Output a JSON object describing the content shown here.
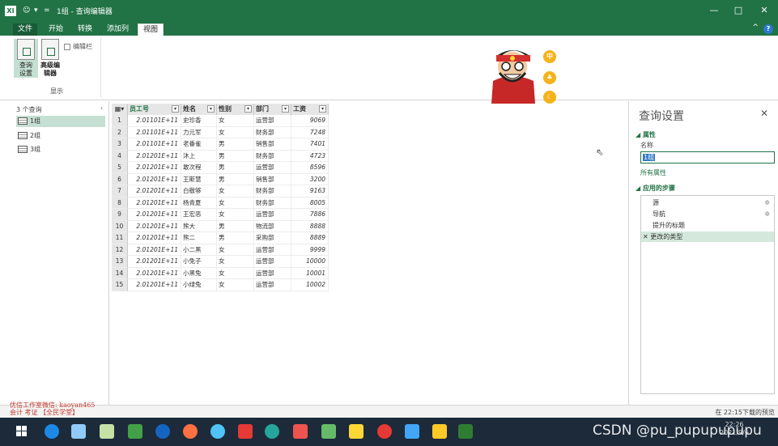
{
  "window": {
    "app_badge": "XΙ",
    "title": "1组 - 查询编辑器",
    "controls": [
      "—",
      "□",
      "✕"
    ]
  },
  "ribbon": {
    "tabs": [
      {
        "label": "文件"
      },
      {
        "label": "开始"
      },
      {
        "label": "转换"
      },
      {
        "label": "添加列"
      },
      {
        "label": "视图"
      }
    ],
    "buttons": {
      "query_settings": "查询\n设置",
      "advanced_editor": "高级编\n辑器",
      "formula_bar": "编辑栏"
    },
    "group_label": "显示"
  },
  "mascot_badges": [
    "中",
    "",
    ""
  ],
  "queries_pane": {
    "header": "3 个查询",
    "items": [
      {
        "label": "1组",
        "selected": true
      },
      {
        "label": "2组",
        "selected": false
      },
      {
        "label": "3组",
        "selected": false
      }
    ]
  },
  "grid": {
    "columns": [
      "员工号",
      "姓名",
      "性别",
      "部门",
      "工资"
    ],
    "rows": [
      {
        "n": "1",
        "id": "2.01101E+11",
        "name": "史珍香",
        "sex": "女",
        "dept": "运营部",
        "salary": "9069"
      },
      {
        "n": "2",
        "id": "2.01101E+11",
        "name": "力元军",
        "sex": "女",
        "dept": "财务部",
        "salary": "7248"
      },
      {
        "n": "3",
        "id": "2.01101E+11",
        "name": "老番雀",
        "sex": "男",
        "dept": "销售部",
        "salary": "7401"
      },
      {
        "n": "4",
        "id": "2.01201E+11",
        "name": "沐上",
        "sex": "男",
        "dept": "财务部",
        "salary": "4723"
      },
      {
        "n": "5",
        "id": "2.01201E+11",
        "name": "敢次程",
        "sex": "男",
        "dept": "运营部",
        "salary": "8596"
      },
      {
        "n": "6",
        "id": "2.01201E+11",
        "name": "王斯慧",
        "sex": "男",
        "dept": "销售部",
        "salary": "3200"
      },
      {
        "n": "7",
        "id": "2.01201E+11",
        "name": "白敬够",
        "sex": "女",
        "dept": "财务部",
        "salary": "9163"
      },
      {
        "n": "8",
        "id": "2.01201E+11",
        "name": "杨青夏",
        "sex": "女",
        "dept": "财务部",
        "salary": "8005"
      },
      {
        "n": "9",
        "id": "2.01201E+11",
        "name": "王宏恶",
        "sex": "女",
        "dept": "运营部",
        "salary": "7886"
      },
      {
        "n": "10",
        "id": "2.01201E+11",
        "name": "熊大",
        "sex": "男",
        "dept": "物流部",
        "salary": "8888"
      },
      {
        "n": "11",
        "id": "2.01201E+11",
        "name": "熊二",
        "sex": "男",
        "dept": "采购部",
        "salary": "8889"
      },
      {
        "n": "12",
        "id": "2.01201E+11",
        "name": "小二黑",
        "sex": "女",
        "dept": "运营部",
        "salary": "9999"
      },
      {
        "n": "13",
        "id": "2.01201E+11",
        "name": "小兔子",
        "sex": "女",
        "dept": "运营部",
        "salary": "10000"
      },
      {
        "n": "14",
        "id": "2.01201E+11",
        "name": "小黑兔",
        "sex": "女",
        "dept": "运营部",
        "salary": "10001"
      },
      {
        "n": "15",
        "id": "2.01201E+11",
        "name": "小绿兔",
        "sex": "女",
        "dept": "运营部",
        "salary": "10002"
      }
    ]
  },
  "settings_pane": {
    "title": "查询设置",
    "close": "✕",
    "properties_header": "◢ 属性",
    "name_label": "名称",
    "name_value": "1组",
    "all_properties": "所有属性",
    "steps_header": "◢ 应用的步骤",
    "steps": [
      {
        "label": "源",
        "gear": true,
        "selected": false
      },
      {
        "label": "导航",
        "gear": true,
        "selected": false
      },
      {
        "label": "提升的标题",
        "gear": false,
        "selected": false
      },
      {
        "label": "✕ 更改的类型",
        "gear": false,
        "selected": true
      }
    ]
  },
  "status": {
    "right": "在 22:15下载的预览"
  },
  "watermark": {
    "line1": "优信工作室微信: kaoyan465",
    "line2": "会计 考证 【全民学堂】"
  },
  "taskbar": {
    "overlay": "CSDN @pu_pupupupupu",
    "clock_time": "22:26",
    "clock_date": "2021/9/6"
  },
  "colors": {
    "accent": "#217346",
    "selected_bg": "#c5e0d2",
    "taskbar": "#1c2a3a"
  }
}
